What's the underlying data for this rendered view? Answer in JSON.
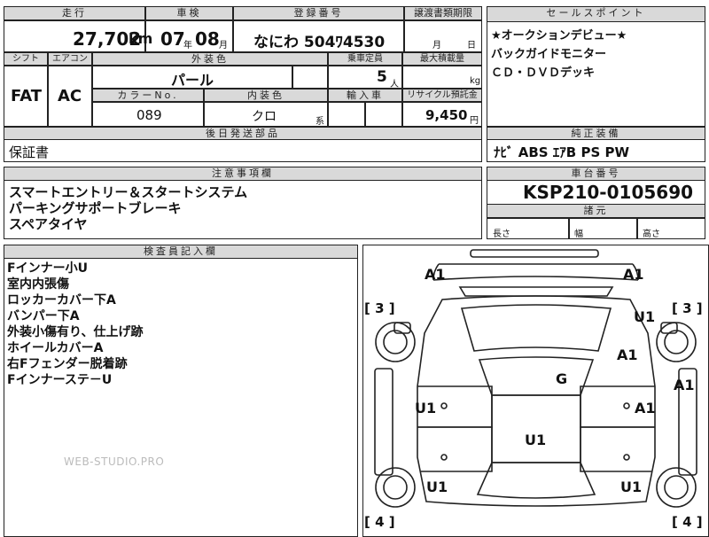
{
  "top_row": {
    "mileage_label": "走行",
    "inspection_label": "車検",
    "registration_label": "登録番号",
    "transfer_deadline_label": "譲渡書類期限",
    "mileage_value": "27,702",
    "mileage_unit": "km",
    "inspection_year": "07",
    "inspection_year_unit": "年",
    "inspection_month": "08",
    "inspection_month_unit": "月",
    "registration_value": "なにわ 504ﾜ4530",
    "deadline_month_unit": "月",
    "deadline_day_unit": "日"
  },
  "sale_points": {
    "header": "セールスポイント",
    "lines": [
      "★オークションデビュー★",
      "バックガイドモニター",
      "ＣＤ・ＤＶＤデッキ"
    ]
  },
  "spec": {
    "shift_label": "シフト",
    "aircon_label": "エアコン",
    "exterior_color_label": "外装色",
    "capacity_label": "乗車定員",
    "max_load_label": "最大積載量",
    "shift_value": "FAT",
    "aircon_value": "AC",
    "exterior_color_value": "パール",
    "capacity_value": "5",
    "capacity_unit": "人",
    "max_load_unit": "kg",
    "color_no_label": "カラーNo.",
    "interior_color_label": "内装色",
    "import_label": "輸入車",
    "recycle_label": "リサイクル預託金",
    "color_no_value": "089",
    "interior_color_value": "クロ",
    "interior_suffix": "系",
    "recycle_value": "9,450",
    "recycle_unit": "円"
  },
  "later_parts": {
    "header": "後日発送部品",
    "value": "保証書"
  },
  "genuine_equipment": {
    "header": "純正装備",
    "value": "ﾅﾋﾞ ABS ｴｱB PS PW"
  },
  "notes": {
    "header": "注意事項欄",
    "lines": [
      "スマートエントリー＆スタートシステム",
      "パーキングサポートブレーキ",
      "スペアタイヤ"
    ]
  },
  "chassis": {
    "header": "車台番号",
    "value": "KSP210-0105690",
    "dims_header": "諸元",
    "length_label": "長さ",
    "width_label": "幅",
    "height_label": "高さ"
  },
  "inspector": {
    "header": "検査員記入欄",
    "lines": [
      "Fインナー小U",
      "室内内張傷",
      "ロッカーカバー下A",
      "バンパー下A",
      "外装小傷有り、仕上げ跡",
      "ホイールカバーA",
      "右Fフェンダー脱着跡",
      "Fインナーステ－U"
    ],
    "watermark": "WEB-STUDIO.PRO"
  },
  "diagram": {
    "marks": {
      "front_left": "A1",
      "front_right": "A1",
      "bracket_left_top": "[ 3 ]",
      "bracket_right_top": "[ 3 ]",
      "right_front_fender": "U1",
      "right_front_door_area": "A1",
      "right_side_edge": "A1",
      "roof": "G",
      "left_front_door": "U1",
      "right_front_door": "A1",
      "center": "U1",
      "left_rear_wheel": "U1",
      "right_rear_wheel": "U1",
      "bracket_left_bottom": "[ 4 ]",
      "bracket_right_bottom": "[ 4 ]"
    }
  }
}
